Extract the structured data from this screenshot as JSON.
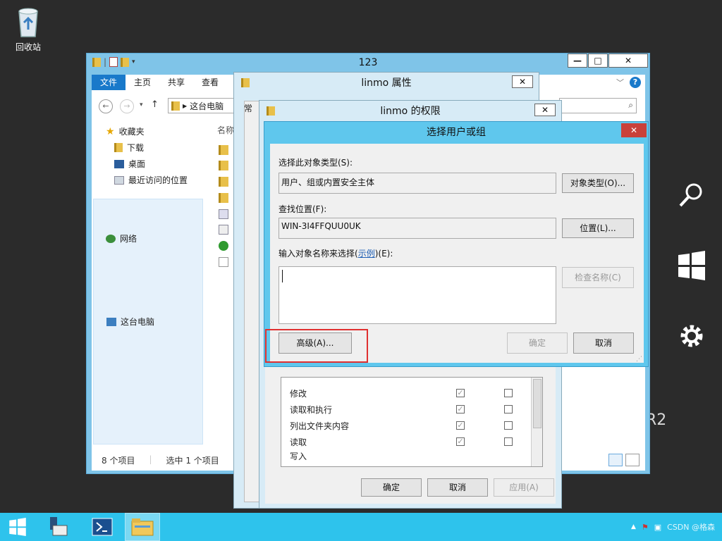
{
  "desktop": {
    "recycle_bin_label": "回收站",
    "os_suffix": "R2"
  },
  "explorer": {
    "title": "123",
    "tabs": [
      "文件",
      "主页",
      "共享",
      "查看"
    ],
    "address": "这台电脑",
    "column_name": "名称",
    "nav": {
      "favorites": "收藏夹",
      "downloads": "下载",
      "desktop": "桌面",
      "recent": "最近访问的位置",
      "this_pc": "这台电脑",
      "network": "网络"
    },
    "status": {
      "count": "8 个项目",
      "selected": "选中 1 个项目"
    }
  },
  "properties": {
    "title": "linmo 属性",
    "tab": "常"
  },
  "permissions": {
    "title": "linmo 的权限",
    "rows": [
      "修改",
      "读取和执行",
      "列出文件夹内容",
      "读取",
      "写入"
    ],
    "ok": "确定",
    "cancel": "取消",
    "apply": "应用(A)"
  },
  "select_users": {
    "title": "选择用户或组",
    "object_type_label": "选择此对象类型(S):",
    "object_type_value": "用户、组或内置安全主体",
    "object_type_button": "对象类型(O)...",
    "location_label": "查找位置(F):",
    "location_value": "WIN-3I4FFQUU0UK",
    "location_button": "位置(L)...",
    "enter_label_pre": "输入对象名称来选择(",
    "enter_label_link": "示例",
    "enter_label_post": ")(E):",
    "check_names_button": "检查名称(C)",
    "advanced_button": "高级(A)...",
    "ok_button": "确定",
    "cancel_button": "取消"
  },
  "taskbar": {
    "tray_text": "CSDN @格森"
  }
}
